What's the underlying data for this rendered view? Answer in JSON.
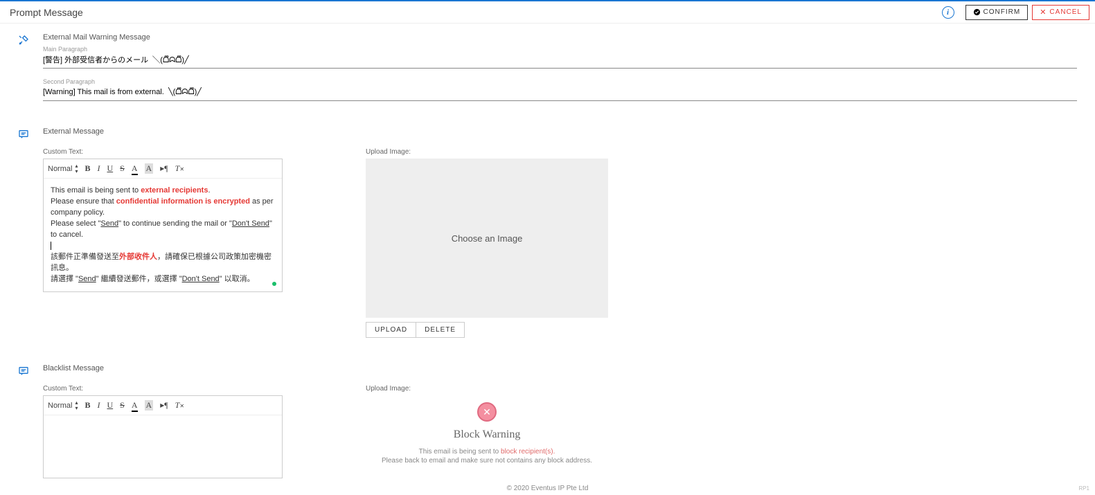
{
  "header": {
    "title": "Prompt Message",
    "confirm_label": "CONFIRM",
    "cancel_label": "CANCEL"
  },
  "section_warning": {
    "title": "External Mail Warning Message",
    "main_label": "Main Paragraph",
    "main_value": "[警告] 外部受信者からのメール  ╲(ᗝຶᗣᗝຶ)╱",
    "second_label": "Second Paragraph",
    "second_value": "[Warning] This mail is from external.  ╲(ᗝຶᗣᗝຶ)╱"
  },
  "section_external": {
    "title": "External Message",
    "custom_label": "Custom Text:",
    "upload_label": "Upload Image:",
    "rte_format": "Normal",
    "content": {
      "l1a": "This email is being sent to ",
      "l1b": "external recipients",
      "l1c": ".",
      "l2a": "Please ensure that ",
      "l2b": "confidential information is encrypted",
      "l2c": " as per company policy.",
      "l3a": "Please select \"",
      "l3b": "Send",
      "l3c": "\" to continue sending the mail or \"",
      "l3d": "Don't Send",
      "l3e": "\" to cancel.",
      "l4a": "該郵件正準備發送至",
      "l4b": "外部收件人",
      "l4c": "，請確保已根據公司政策加密機密訊息。",
      "l5a": "請選擇 \"",
      "l5b": "Send",
      "l5c": "\" 繼續發送郵件，或選擇 \"",
      "l5d": "Don't Send",
      "l5e": "\" 以取消。"
    },
    "choose_image": "Choose an Image",
    "upload_btn": "UPLOAD",
    "delete_btn": "DELETE"
  },
  "section_blacklist": {
    "title": "Blacklist Message",
    "custom_label": "Custom Text:",
    "upload_label": "Upload Image:",
    "rte_format": "Normal",
    "block_title": "Block Warning",
    "block_line1a": "This email is being sent to ",
    "block_line1b": "block recipient(s).",
    "block_line2": "Please back to email and make sure not contains any block address."
  },
  "footer": {
    "copyright": "© 2020 Eventus IP Pte Ltd",
    "tag": "RP1"
  }
}
